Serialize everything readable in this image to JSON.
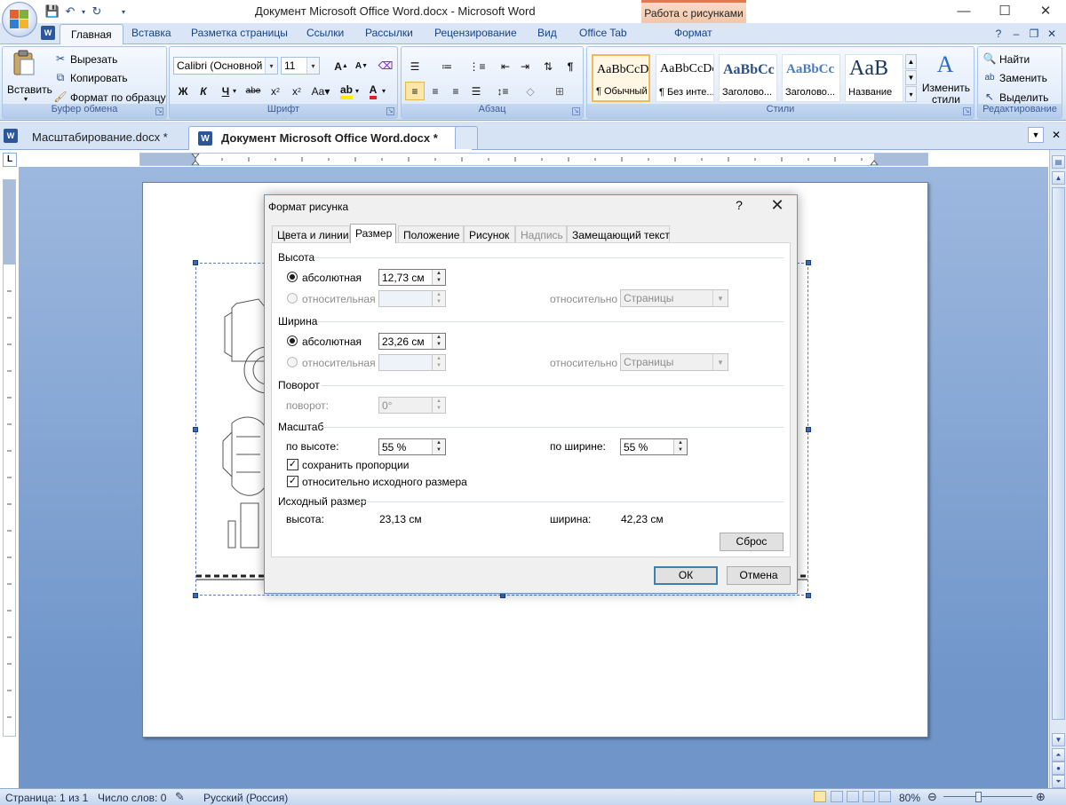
{
  "titlebar": {
    "title": "Документ Microsoft Office Word.docx - Microsoft Word",
    "context_tab": "Работа с рисунками",
    "minimize": "—",
    "maximize": "☐",
    "close": "✕"
  },
  "ribbon_tabs": [
    "Главная",
    "Вставка",
    "Разметка страницы",
    "Ссылки",
    "Рассылки",
    "Рецензирование",
    "Вид",
    "Office Tab",
    "Формат"
  ],
  "ribbon": {
    "clipboard": {
      "label": "Буфер обмена",
      "paste": "Вставить",
      "cut": "Вырезать",
      "copy": "Копировать",
      "format_painter": "Формат по образцу"
    },
    "font": {
      "label": "Шрифт",
      "font_name": "Calibri (Основной те",
      "font_size": "11"
    },
    "paragraph": {
      "label": "Абзац"
    },
    "styles": {
      "label": "Стили",
      "items": [
        {
          "sample": "AaBbCcDc",
          "name": "¶ Обычный"
        },
        {
          "sample": "AaBbCcDc",
          "name": "¶ Без инте..."
        },
        {
          "sample": "AaBbCc",
          "name": "Заголово..."
        },
        {
          "sample": "AaBbCc",
          "name": "Заголово..."
        },
        {
          "sample": "AaB",
          "name": "Название"
        }
      ],
      "change_styles": "Изменить стили"
    },
    "editing": {
      "label": "Редактирование",
      "find": "Найти",
      "replace": "Заменить",
      "select": "Выделить"
    }
  },
  "doc_tabs": [
    {
      "label": "Масштабирование.docx *"
    },
    {
      "label": "Документ Microsoft Office Word.docx *"
    }
  ],
  "ruler_corner": "L",
  "dialog": {
    "title": "Формат рисунка",
    "help": "?",
    "close": "✕",
    "tabs": [
      "Цвета и линии",
      "Размер",
      "Положение",
      "Рисунок",
      "Надпись",
      "Замещающий текст"
    ],
    "height": {
      "section": "Высота",
      "absolute_label": "абсолютная",
      "absolute_value": "12,73 см",
      "relative_label": "относительная",
      "relative_to_label": "относительно",
      "relative_to_value": "Страницы"
    },
    "width": {
      "section": "Ширина",
      "absolute_label": "абсолютная",
      "absolute_value": "23,26 см",
      "relative_label": "относительная",
      "relative_to_label": "относительно",
      "relative_to_value": "Страницы"
    },
    "rotation": {
      "section": "Поворот",
      "label": "поворот:",
      "value": "0°"
    },
    "scale": {
      "section": "Масштаб",
      "height_label": "по высоте:",
      "height_value": "55 %",
      "width_label": "по ширине:",
      "width_value": "55 %",
      "lock_aspect": "сохранить пропорции",
      "relative_original": "относительно исходного размера"
    },
    "original": {
      "section": "Исходный размер",
      "height_label": "высота:",
      "height_value": "23,13 см",
      "width_label": "ширина:",
      "width_value": "42,23 см"
    },
    "reset": "Сброс",
    "ok": "ОК",
    "cancel": "Отмена"
  },
  "statusbar": {
    "page": "Страница: 1 из 1",
    "words": "Число слов: 0",
    "language": "Русский (Россия)",
    "zoom": "80%"
  },
  "colors": {
    "ribbon_bg": "#dde9f8",
    "doc_bg": "#7d9ed0",
    "accent": "#15428b"
  }
}
